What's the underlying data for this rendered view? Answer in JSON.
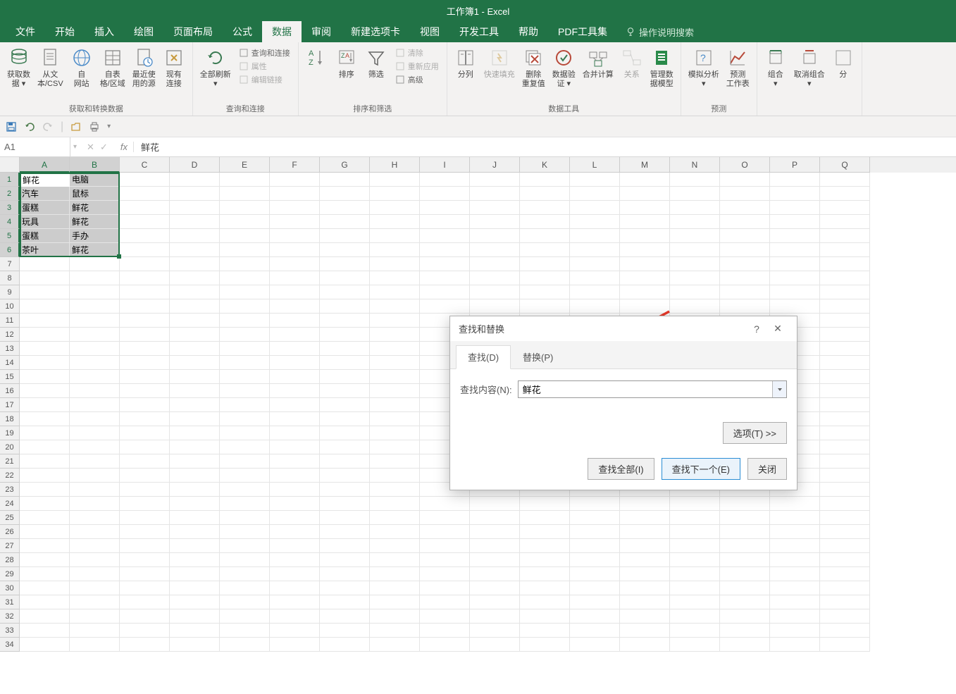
{
  "app_title": "工作簿1 - Excel",
  "menu": {
    "tabs": [
      "文件",
      "开始",
      "插入",
      "绘图",
      "页面布局",
      "公式",
      "数据",
      "审阅",
      "新建选项卡",
      "视图",
      "开发工具",
      "帮助",
      "PDF工具集"
    ],
    "active_index": 6,
    "tell_me": "操作说明搜索"
  },
  "ribbon": {
    "groups": [
      {
        "label": "获取和转换数据",
        "buttons": [
          {
            "name": "get-data",
            "label": "获取数\n据 ▾"
          },
          {
            "name": "from-text-csv",
            "label": "从文\n本/CSV"
          },
          {
            "name": "from-web",
            "label": "自\n网站"
          },
          {
            "name": "from-table",
            "label": "自表\n格/区域"
          },
          {
            "name": "recent-sources",
            "label": "最近使\n用的源"
          },
          {
            "name": "existing-conn",
            "label": "现有\n连接"
          }
        ]
      },
      {
        "label": "查询和连接",
        "buttons": [
          {
            "name": "refresh-all",
            "label": "全部刷新\n▾"
          }
        ],
        "small": [
          {
            "name": "queries-conn",
            "label": "查询和连接"
          },
          {
            "name": "properties",
            "label": "属性",
            "disabled": true
          },
          {
            "name": "edit-links",
            "label": "编辑链接",
            "disabled": true
          }
        ]
      },
      {
        "label": "排序和筛选",
        "buttons": [
          {
            "name": "sort-az",
            "label": ""
          },
          {
            "name": "sort",
            "label": "排序"
          },
          {
            "name": "filter",
            "label": "筛选"
          }
        ],
        "small": [
          {
            "name": "clear",
            "label": "清除",
            "disabled": true
          },
          {
            "name": "reapply",
            "label": "重新应用",
            "disabled": true
          },
          {
            "name": "advanced",
            "label": "高级"
          }
        ]
      },
      {
        "label": "数据工具",
        "buttons": [
          {
            "name": "text-to-col",
            "label": "分列"
          },
          {
            "name": "flash-fill",
            "label": "快速填充",
            "disabled": true
          },
          {
            "name": "remove-dup",
            "label": "删除\n重复值"
          },
          {
            "name": "data-valid",
            "label": "数据验\n证 ▾"
          },
          {
            "name": "consolidate",
            "label": "合并计算"
          },
          {
            "name": "relationships",
            "label": "关系",
            "disabled": true
          },
          {
            "name": "manage-model",
            "label": "管理数\n据模型"
          }
        ]
      },
      {
        "label": "预测",
        "buttons": [
          {
            "name": "whatif",
            "label": "模拟分析\n▾"
          },
          {
            "name": "forecast",
            "label": "预测\n工作表"
          }
        ]
      },
      {
        "label": "",
        "buttons": [
          {
            "name": "group",
            "label": "组合\n▾"
          },
          {
            "name": "ungroup",
            "label": "取消组合\n▾"
          },
          {
            "name": "subtotal",
            "label": "分"
          }
        ]
      }
    ]
  },
  "qat": {
    "items": [
      "save",
      "undo",
      "redo",
      "sep",
      "touch",
      "more",
      "sep2"
    ]
  },
  "formula_bar": {
    "name_box": "A1",
    "value": "鲜花"
  },
  "grid": {
    "columns": [
      "A",
      "B",
      "C",
      "D",
      "E",
      "F",
      "G",
      "H",
      "I",
      "J",
      "K",
      "L",
      "M",
      "N",
      "O",
      "P",
      "Q"
    ],
    "selected_cols": [
      0,
      1
    ],
    "selected_rows": [
      1,
      2,
      3,
      4,
      5,
      6
    ],
    "active_cell_value": "鲜花",
    "data": [
      [
        "鲜花",
        "电脑"
      ],
      [
        "汽车",
        "鼠标"
      ],
      [
        "蛋糕",
        "鲜花"
      ],
      [
        "玩具",
        "鲜花"
      ],
      [
        "蛋糕",
        "手办"
      ],
      [
        "茶叶",
        "鲜花"
      ]
    ],
    "total_rows": 34
  },
  "dialog": {
    "title": "查找和替换",
    "tabs": [
      {
        "label": "查找(D)",
        "active": true
      },
      {
        "label": "替换(P)",
        "active": false
      }
    ],
    "find_label": "查找内容(N):",
    "find_value": "鲜花",
    "options_btn": "选项(T) >>",
    "buttons": {
      "find_all": "查找全部(I)",
      "find_next": "查找下一个(E)",
      "close": "关闭"
    }
  },
  "annotation": {
    "arrow_color": "#e83a2a"
  }
}
